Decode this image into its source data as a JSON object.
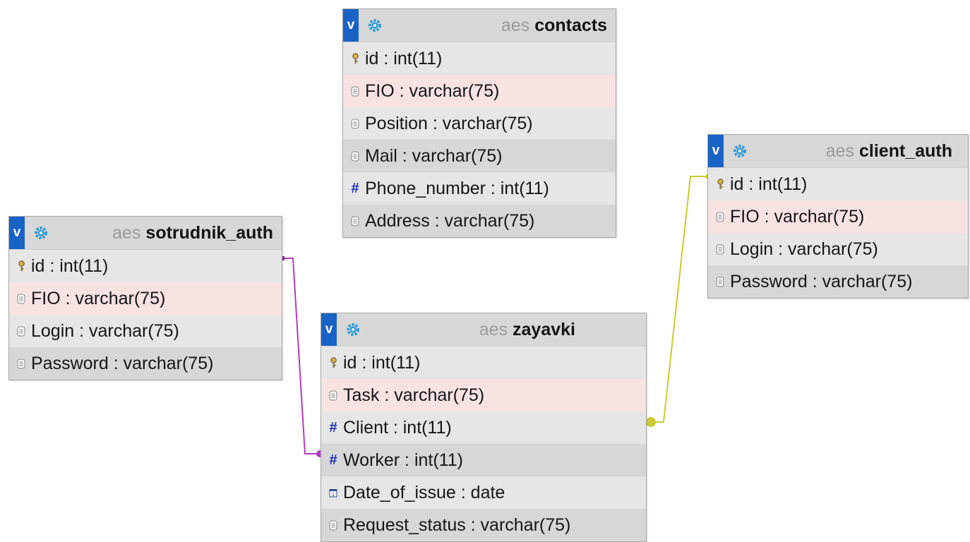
{
  "tables": [
    {
      "id": "contacts",
      "db": "aes",
      "name": "contacts",
      "toggle": "v",
      "columns": [
        {
          "label": "id : int(11)",
          "icon": "key-icon"
        },
        {
          "label": "FIO : varchar(75)",
          "icon": "text-column-icon"
        },
        {
          "label": "Position : varchar(75)",
          "icon": "text-column-icon"
        },
        {
          "label": "Mail : varchar(75)",
          "icon": "text-column-icon"
        },
        {
          "label": "Phone_number : int(11)",
          "icon": "numeric-column-icon"
        },
        {
          "label": "Address : varchar(75)",
          "icon": "text-column-icon"
        }
      ]
    },
    {
      "id": "sotrudnik_auth",
      "db": "aes",
      "name": "sotrudnik_auth",
      "toggle": "v",
      "columns": [
        {
          "label": "id : int(11)",
          "icon": "key-icon"
        },
        {
          "label": "FIO : varchar(75)",
          "icon": "text-column-icon"
        },
        {
          "label": "Login : varchar(75)",
          "icon": "text-column-icon"
        },
        {
          "label": "Password : varchar(75)",
          "icon": "text-column-icon"
        }
      ]
    },
    {
      "id": "zayavki",
      "db": "aes",
      "name": "zayavki",
      "toggle": "v",
      "columns": [
        {
          "label": "id : int(11)",
          "icon": "key-icon"
        },
        {
          "label": "Task : varchar(75)",
          "icon": "text-column-icon"
        },
        {
          "label": "Client : int(11)",
          "icon": "numeric-column-icon"
        },
        {
          "label": "Worker : int(11)",
          "icon": "numeric-column-icon"
        },
        {
          "label": "Date_of_issue : date",
          "icon": "date-column-icon"
        },
        {
          "label": "Request_status : varchar(75)",
          "icon": "text-column-icon"
        }
      ]
    },
    {
      "id": "client_auth",
      "db": "aes",
      "name": "client_auth",
      "toggle": "v",
      "columns": [
        {
          "label": "id : int(11)",
          "icon": "key-icon"
        },
        {
          "label": "FIO : varchar(75)",
          "icon": "text-column-icon"
        },
        {
          "label": "Login : varchar(75)",
          "icon": "text-column-icon"
        },
        {
          "label": "Password : varchar(75)",
          "icon": "text-column-icon"
        }
      ]
    }
  ],
  "relations": [
    {
      "from": "zayavki.Worker",
      "to": "sotrudnik_auth.id",
      "color": "#b43bc4"
    },
    {
      "from": "zayavki.Client",
      "to": "client_auth.id",
      "color": "#cbcb2e"
    }
  ]
}
